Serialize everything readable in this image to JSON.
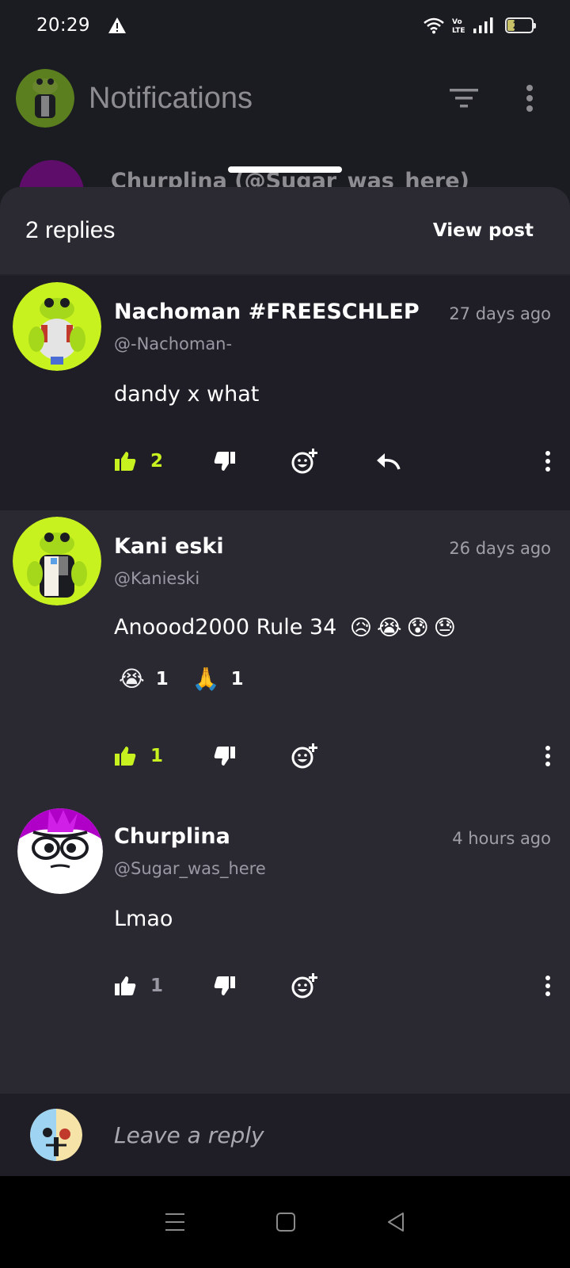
{
  "status_bar": {
    "time": "20:29",
    "battery": "29",
    "icons": [
      "warning-icon",
      "wifi-icon",
      "volte-icon",
      "signal-icon",
      "battery-icon"
    ]
  },
  "app_bar": {
    "title": "Notifications",
    "icons": [
      "filter-icon",
      "more-vertical-icon"
    ]
  },
  "background_notification": {
    "text": "Churplina (@Sugar_was_here)"
  },
  "sheet": {
    "header_title": "2 replies",
    "view_post_label": "View post"
  },
  "comments": [
    {
      "author": "Nachoman #FREESCHLEP",
      "handle": "@-Nachoman-",
      "time": "27 days ago",
      "text": "dandy x what",
      "likes": "2",
      "liked": true,
      "reactions": []
    },
    {
      "author": "Kani eski",
      "handle": "@Kanieski",
      "time": "26 days ago",
      "text": "Anoood2000 Rule 34",
      "text_emojis": [
        "😥",
        "😭",
        "😰",
        "😓"
      ],
      "likes": "1",
      "liked": true,
      "reactions": [
        {
          "emoji": "😭",
          "count": "1"
        },
        {
          "emoji": "🙏",
          "count": "1"
        }
      ]
    },
    {
      "author": "Churplina",
      "handle": "@Sugar_was_here",
      "time": "4 hours ago",
      "text": "Lmao",
      "likes": "1",
      "liked": false,
      "reactions": []
    }
  ],
  "reply_bar": {
    "placeholder": "Leave a reply"
  },
  "colors": {
    "accent_green": "#c8f21f",
    "sheet_bg": "#2a2932",
    "highlight_bg": "#1f1e26"
  },
  "nav_bar": {
    "icons": [
      "menu-icon",
      "home-square-icon",
      "back-triangle-icon"
    ]
  }
}
